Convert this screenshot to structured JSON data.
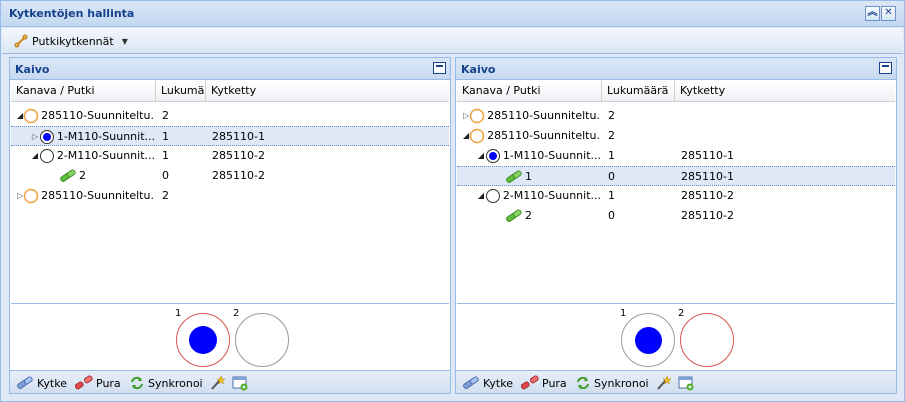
{
  "window": {
    "title": "Kytkentöjen hallinta"
  },
  "toolbar": {
    "menu_label": "Putkikytkennät"
  },
  "left": {
    "title": "Kaivo",
    "columns": [
      "Kanava / Putki",
      "Lukumäärä",
      "Kytketty"
    ],
    "rows": [
      {
        "name": "285110-Suunniteltu...",
        "count": "2",
        "connected": ""
      },
      {
        "name": "1-M110-Suunnit...",
        "count": "1",
        "connected": "285110-1"
      },
      {
        "name": "2-M110-Suunnit...",
        "count": "1",
        "connected": "285110-2"
      },
      {
        "name": "2",
        "count": "0",
        "connected": "285110-2"
      },
      {
        "name": "285110-Suunniteltu...",
        "count": "2",
        "connected": ""
      }
    ],
    "circles": [
      "1",
      "2"
    ],
    "footer": {
      "connect": "Kytke",
      "disconnect": "Pura",
      "sync": "Synkronoi"
    }
  },
  "right": {
    "title": "Kaivo",
    "columns": [
      "Kanava / Putki",
      "Lukumäärä",
      "Kytketty"
    ],
    "rows": [
      {
        "name": "285110-Suunniteltu...",
        "count": "2",
        "connected": ""
      },
      {
        "name": "285110-Suunniteltu...",
        "count": "2",
        "connected": ""
      },
      {
        "name": "1-M110-Suunnit...",
        "count": "1",
        "connected": "285110-1"
      },
      {
        "name": "1",
        "count": "0",
        "connected": "285110-1"
      },
      {
        "name": "2-M110-Suunnit...",
        "count": "1",
        "connected": "285110-2"
      },
      {
        "name": "2",
        "count": "0",
        "connected": "285110-2"
      }
    ],
    "circles": [
      "1",
      "2"
    ],
    "footer": {
      "connect": "Kytke",
      "disconnect": "Pura",
      "sync": "Synkronoi"
    }
  },
  "colors": {
    "header_text": "#15428b",
    "border": "#99bbe8",
    "selection": "#dfe8f6",
    "circle_fill": "#0000ff",
    "circle_red": "#d9534f"
  }
}
